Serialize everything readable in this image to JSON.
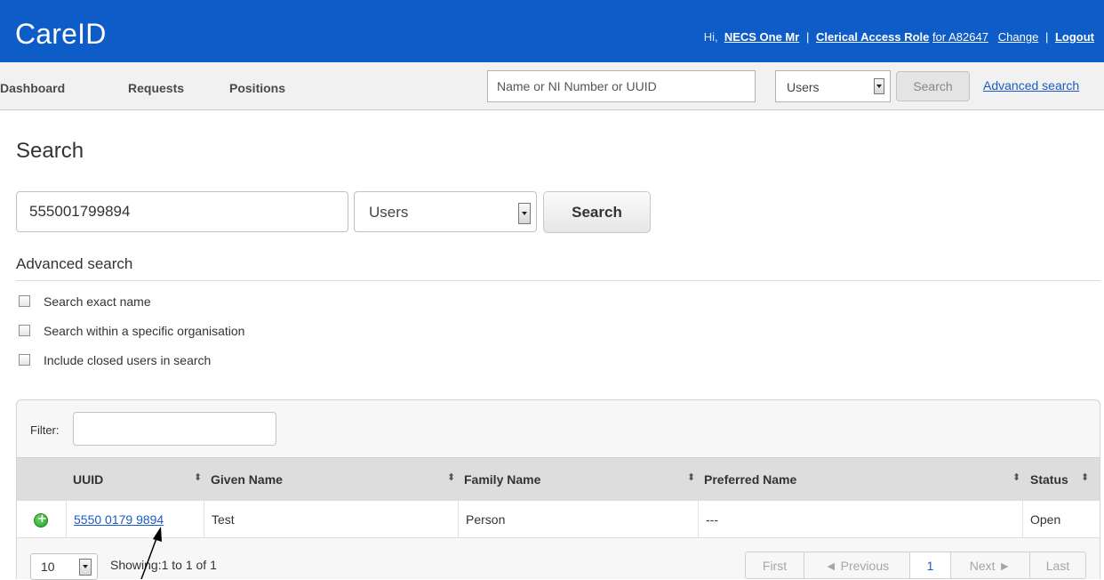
{
  "app": {
    "logo": "CareID",
    "greeting": "Hi,",
    "user_name": "NECS One Mr",
    "role_link": "Clerical Access Role",
    "role_suffix": "for A82647",
    "change_link": "Change",
    "logout_link": "Logout",
    "separator": "|"
  },
  "nav": {
    "items": [
      {
        "label": "Dashboard"
      },
      {
        "label": "Requests"
      },
      {
        "label": "Positions"
      }
    ],
    "search_placeholder": "Name or NI Number or UUID",
    "search_type": "Users",
    "search_button": "Search",
    "advanced_link": "Advanced search"
  },
  "page": {
    "title": "Search",
    "search_value": "555001799894",
    "search_type": "Users",
    "search_button": "Search",
    "advanced_heading": "Advanced search",
    "options": [
      {
        "label": "Search exact name",
        "checked": false
      },
      {
        "label": "Search within a specific organisation",
        "checked": false
      },
      {
        "label": "Include closed users in search",
        "checked": false
      }
    ]
  },
  "results": {
    "filter_label": "Filter:",
    "filter_value": "",
    "columns": [
      "UUID",
      "Given Name",
      "Family Name",
      "Preferred Name",
      "Status"
    ],
    "rows": [
      {
        "uuid": "5550 0179 9894",
        "given_name": "Test",
        "family_name": "Person",
        "preferred_name": "---",
        "status": "Open"
      }
    ],
    "page_size": "10",
    "showing": "Showing:1 to 1 of 1",
    "pagination": {
      "first": "First",
      "previous": "◄ Previous",
      "current_page": "1",
      "next": "Next ►",
      "last": "Last"
    }
  },
  "colors": {
    "brand_blue": "#0d5cc7",
    "link_blue": "#1a5bc4",
    "expand_green": "#23a023"
  },
  "icons": {
    "row_expand": "plus-circle-icon",
    "sort": "sort-updown-icon",
    "dropdown": "chevron-down-icon"
  }
}
